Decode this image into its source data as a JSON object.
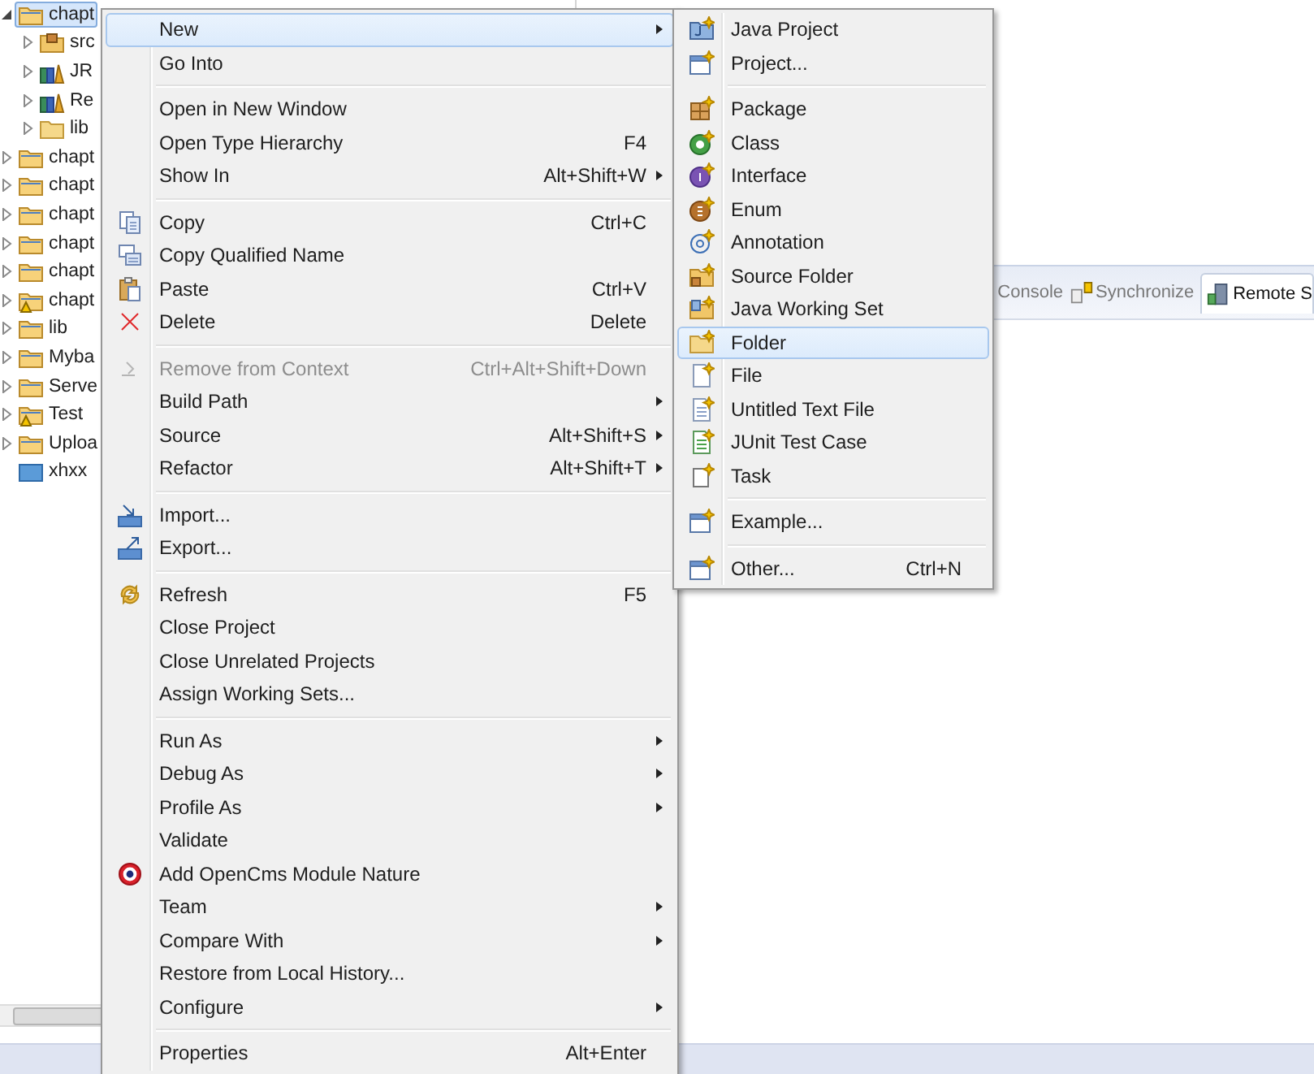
{
  "tree": {
    "items": [
      {
        "label": "chapt",
        "kind": "project",
        "warning": false,
        "expandable": true,
        "expanded": true,
        "selected": true,
        "children": [
          {
            "label": "src",
            "kind": "source",
            "expandable": true,
            "expanded": false,
            "selected": false
          },
          {
            "label": "JR",
            "kind": "library",
            "expandable": true,
            "expanded": false,
            "selected": false
          },
          {
            "label": "Re",
            "kind": "library",
            "expandable": true,
            "expanded": false,
            "selected": false
          },
          {
            "label": "lib",
            "kind": "folder",
            "expandable": true,
            "expanded": false,
            "selected": false
          }
        ]
      },
      {
        "label": "chapt",
        "kind": "project",
        "warning": false,
        "expandable": true,
        "expanded": false,
        "selected": false
      },
      {
        "label": "chapt",
        "kind": "project",
        "warning": false,
        "expandable": true,
        "expanded": false,
        "selected": false
      },
      {
        "label": "chapt",
        "kind": "project",
        "warning": false,
        "expandable": true,
        "expanded": false,
        "selected": false
      },
      {
        "label": "chapt",
        "kind": "project",
        "warning": false,
        "expandable": true,
        "expanded": false,
        "selected": false
      },
      {
        "label": "chapt",
        "kind": "project",
        "warning": false,
        "expandable": true,
        "expanded": false,
        "selected": false
      },
      {
        "label": "chapt",
        "kind": "project",
        "warning": true,
        "expandable": true,
        "expanded": false,
        "selected": false
      },
      {
        "label": "lib",
        "kind": "project",
        "warning": false,
        "expandable": true,
        "expanded": false,
        "selected": false
      },
      {
        "label": "Myba",
        "kind": "project",
        "warning": false,
        "expandable": true,
        "expanded": false,
        "selected": false
      },
      {
        "label": "Serve",
        "kind": "project",
        "warning": false,
        "expandable": true,
        "expanded": false,
        "selected": false
      },
      {
        "label": "Test",
        "kind": "project",
        "warning": true,
        "expandable": true,
        "expanded": false,
        "selected": false
      },
      {
        "label": "Uploa",
        "kind": "project",
        "warning": false,
        "expandable": true,
        "expanded": false,
        "selected": false
      },
      {
        "label": "xhxx",
        "kind": "closed-project",
        "expandable": false,
        "selected": false
      }
    ]
  },
  "tabs": [
    {
      "label": "Console",
      "selected": false
    },
    {
      "label": "Synchronize",
      "selected": false
    },
    {
      "label": "Remote S",
      "selected": true
    }
  ],
  "context_menu": {
    "sections": [
      [
        {
          "label": "New",
          "submenu": true,
          "selected": true,
          "disabled": false
        },
        {
          "label": "Go Into",
          "submenu": false,
          "selected": false,
          "disabled": false
        }
      ],
      [
        {
          "label": "Open in New Window",
          "submenu": false,
          "selected": false,
          "disabled": false
        },
        {
          "label": "Open Type Hierarchy",
          "shortcut": "F4",
          "submenu": false,
          "selected": false,
          "disabled": false
        },
        {
          "label": "Show In",
          "shortcut": "Alt+Shift+W",
          "submenu": true,
          "selected": false,
          "disabled": false
        }
      ],
      [
        {
          "label": "Copy",
          "shortcut": "Ctrl+C",
          "submenu": false,
          "selected": false,
          "disabled": false
        },
        {
          "label": "Copy Qualified Name",
          "submenu": false,
          "selected": false,
          "disabled": false
        },
        {
          "label": "Paste",
          "shortcut": "Ctrl+V",
          "submenu": false,
          "selected": false,
          "disabled": false
        },
        {
          "label": "Delete",
          "shortcut": "Delete",
          "submenu": false,
          "selected": false,
          "disabled": false
        }
      ],
      [
        {
          "label": "Remove from Context",
          "shortcut": "Ctrl+Alt+Shift+Down",
          "submenu": false,
          "selected": false,
          "disabled": true
        },
        {
          "label": "Build Path",
          "submenu": true,
          "selected": false,
          "disabled": false
        },
        {
          "label": "Source",
          "shortcut": "Alt+Shift+S",
          "submenu": true,
          "selected": false,
          "disabled": false
        },
        {
          "label": "Refactor",
          "shortcut": "Alt+Shift+T",
          "submenu": true,
          "selected": false,
          "disabled": false
        }
      ],
      [
        {
          "label": "Import...",
          "submenu": false,
          "selected": false,
          "disabled": false
        },
        {
          "label": "Export...",
          "submenu": false,
          "selected": false,
          "disabled": false
        }
      ],
      [
        {
          "label": "Refresh",
          "shortcut": "F5",
          "submenu": false,
          "selected": false,
          "disabled": false
        },
        {
          "label": "Close Project",
          "submenu": false,
          "selected": false,
          "disabled": false
        },
        {
          "label": "Close Unrelated Projects",
          "submenu": false,
          "selected": false,
          "disabled": false
        },
        {
          "label": "Assign Working Sets...",
          "submenu": false,
          "selected": false,
          "disabled": false
        }
      ],
      [
        {
          "label": "Run As",
          "submenu": true,
          "selected": false,
          "disabled": false
        },
        {
          "label": "Debug As",
          "submenu": true,
          "selected": false,
          "disabled": false
        },
        {
          "label": "Profile As",
          "submenu": true,
          "selected": false,
          "disabled": false
        },
        {
          "label": "Validate",
          "submenu": false,
          "selected": false,
          "disabled": false
        },
        {
          "label": "Add OpenCms Module Nature",
          "submenu": false,
          "selected": false,
          "disabled": false
        },
        {
          "label": "Team",
          "submenu": true,
          "selected": false,
          "disabled": false
        },
        {
          "label": "Compare With",
          "submenu": true,
          "selected": false,
          "disabled": false
        },
        {
          "label": "Restore from Local History...",
          "submenu": false,
          "selected": false,
          "disabled": false
        },
        {
          "label": "Configure",
          "submenu": true,
          "selected": false,
          "disabled": false
        }
      ],
      [
        {
          "label": "Properties",
          "shortcut": "Alt+Enter",
          "submenu": false,
          "selected": false,
          "disabled": false
        }
      ]
    ]
  },
  "submenu": {
    "sections": [
      [
        {
          "label": "Java Project",
          "selected": false
        },
        {
          "label": "Project...",
          "selected": false
        }
      ],
      [
        {
          "label": "Package",
          "selected": false
        },
        {
          "label": "Class",
          "selected": false
        },
        {
          "label": "Interface",
          "selected": false
        },
        {
          "label": "Enum",
          "selected": false
        },
        {
          "label": "Annotation",
          "selected": false
        },
        {
          "label": "Source Folder",
          "selected": false
        },
        {
          "label": "Java Working Set",
          "selected": false
        },
        {
          "label": "Folder",
          "selected": true
        },
        {
          "label": "File",
          "selected": false
        },
        {
          "label": "Untitled Text File",
          "selected": false
        },
        {
          "label": "JUnit Test Case",
          "selected": false
        },
        {
          "label": "Task",
          "selected": false
        }
      ],
      [
        {
          "label": "Example...",
          "selected": false
        }
      ],
      [
        {
          "label": "Other...",
          "shortcut": "Ctrl+N",
          "selected": false
        }
      ]
    ]
  }
}
